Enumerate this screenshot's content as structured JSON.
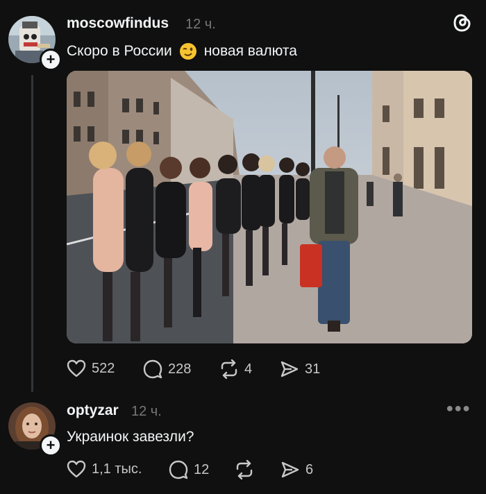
{
  "post": {
    "username": "moscowfindus",
    "time": "12 ч.",
    "text": "Скоро в России",
    "text_after_emoji": "новая валюта",
    "emoji": "winking-face",
    "likes": "522",
    "comments": "228",
    "reposts": "4",
    "shares": "31"
  },
  "reply": {
    "username": "optyzar",
    "time": "12 ч.",
    "text": "Украинок завезли?",
    "likes": "1,1 тыс.",
    "comments": "12",
    "shares": "6"
  },
  "icons": {
    "app_logo": "threads-logo-icon",
    "like": "heart-icon",
    "comment": "comment-bubble-icon",
    "repost": "repost-icon",
    "share": "send-icon",
    "follow": "plus-icon",
    "more": "more-options-icon"
  },
  "colors": {
    "background": "#101010",
    "text": "#f3f5f7",
    "muted": "#777777"
  }
}
